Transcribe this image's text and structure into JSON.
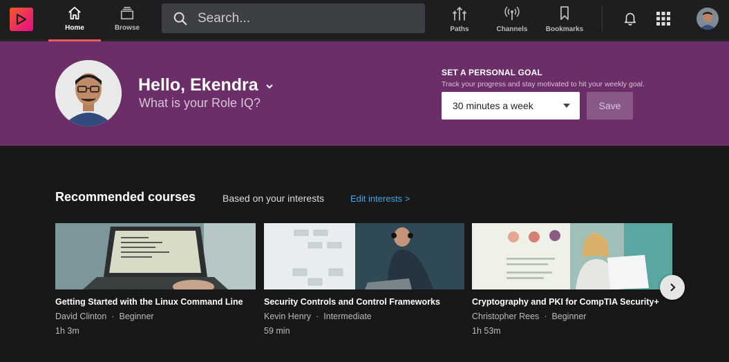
{
  "nav": {
    "tabs": [
      {
        "label": "Home",
        "icon": "home-icon"
      },
      {
        "label": "Browse",
        "icon": "browse-icon"
      }
    ],
    "search_placeholder": "Search...",
    "right_tabs": [
      {
        "label": "Paths",
        "icon": "paths-icon"
      },
      {
        "label": "Channels",
        "icon": "channels-icon"
      },
      {
        "label": "Bookmarks",
        "icon": "bookmark-icon"
      }
    ],
    "accent": "#f15b5b"
  },
  "banner": {
    "greeting": "Hello, Ekendra",
    "role_iq": "What is your Role IQ?",
    "goal_title": "SET A PERSONAL GOAL",
    "goal_subtitle": "Track your progress and stay motivated to hit your weekly goal.",
    "goal_selected": "30 minutes a week",
    "save_label": "Save",
    "bg_color": "#6b2e68"
  },
  "recommended": {
    "title": "Recommended courses",
    "subtitle": "Based on your interests",
    "edit_link": "Edit interests >",
    "courses": [
      {
        "title": "Getting Started with the Linux Command Line",
        "author": "David Clinton",
        "level": "Beginner",
        "duration": "1h 3m"
      },
      {
        "title": "Security Controls and Control Frameworks",
        "author": "Kevin Henry",
        "level": "Intermediate",
        "duration": "59 min"
      },
      {
        "title": "Cryptography and PKI for CompTIA Security+",
        "author": "Christopher Rees",
        "level": "Beginner",
        "duration": "1h 53m"
      }
    ]
  }
}
